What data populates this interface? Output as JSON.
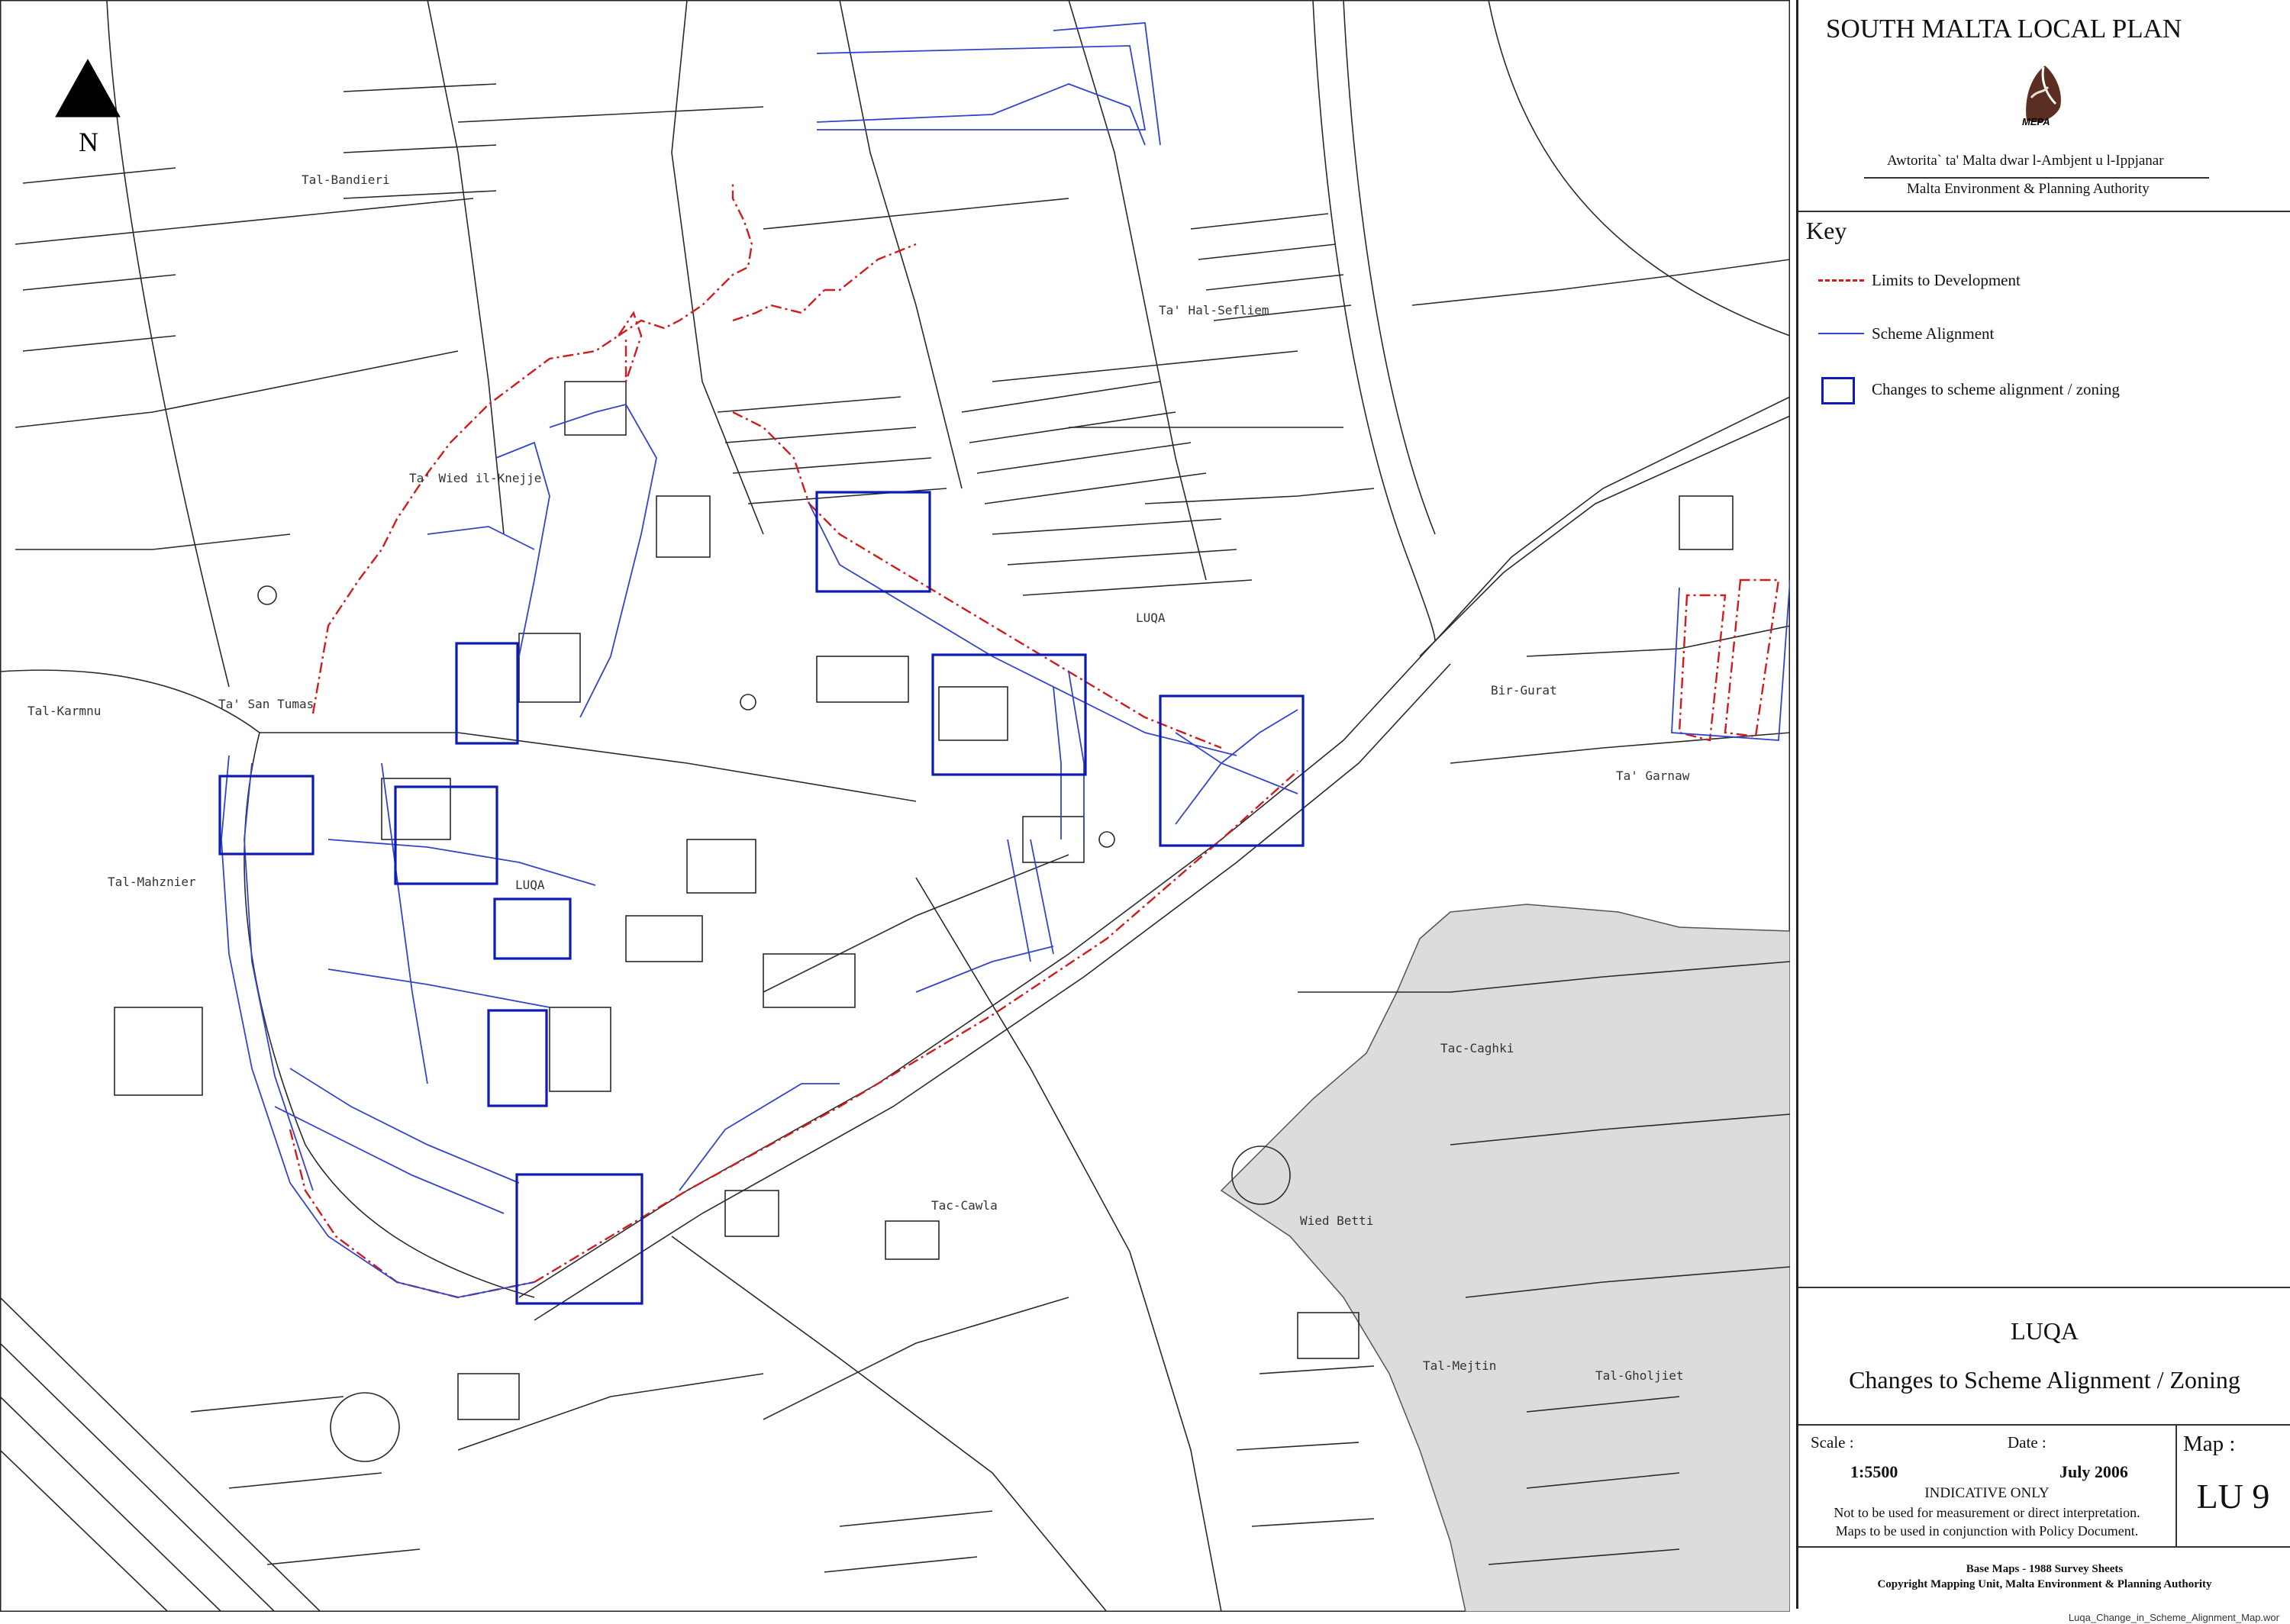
{
  "panel": {
    "plan_title": "SOUTH MALTA LOCAL PLAN",
    "logo_text": "MEPA",
    "authority_maltese": "Awtorita` ta' Malta dwar l-Ambjent u l-Ippjanar",
    "authority_english": "Malta Environment & Planning Authority",
    "key_heading": "Key",
    "key_items": [
      {
        "label": "Limits to Development",
        "symbol": "dash-dot-red-line",
        "color": "#d01c1c"
      },
      {
        "label": "Scheme Alignment",
        "symbol": "thin-blue-line",
        "color": "#3344cc"
      },
      {
        "label": "Changes to scheme alignment / zoning",
        "symbol": "blue-box",
        "color": "#0d1bb3"
      }
    ],
    "locality": "LUQA",
    "map_subject": "Changes to Scheme Alignment / Zoning",
    "scale_label": "Scale :",
    "scale_value": "1:5500",
    "date_label": "Date :",
    "date_value": "July 2006",
    "indicative": "INDICATIVE ONLY",
    "note_1": "Not to be used for measurement or direct interpretation.",
    "note_2": "Maps to be used in conjunction with Policy Document.",
    "map_label": "Map :",
    "map_number": "LU 9",
    "source_1": "Base Maps - 1988 Survey Sheets",
    "source_2": "Copyright Mapping Unit, Malta Environment & Planning Authority"
  },
  "filename": "Luqa_Change_in_Scheme_Alignment_Map.wor",
  "north_label": "N",
  "map_labels": {
    "tal_bandieri": "Tal-Bandieri",
    "ta_hal_sefliem": "Ta' Hal-Sefliem",
    "ta_wied_il_knejjes": "Ta' Wied il-Knejje",
    "luqa_1": "LUQA",
    "luqa_2": "LUQA",
    "bir_gurat": "Bir-Gurat",
    "tal_karmnu": "Tal-Karmnu",
    "ta_san_tumas": "Ta' San Tumas",
    "ta_garnaw": "Ta' Garnaw",
    "tal_mahznier": "Tal-Mahznier",
    "tac_caghki": "Tac-Caghki",
    "tac_cawla": "Tac-Cawla",
    "wied_betti": "Wied Betti",
    "tal_mejtin": "Tal-Mejtin",
    "tal_gholjiet": "Tal-Gholjiet"
  },
  "colors": {
    "limits_line": "#d01c1c",
    "scheme_line": "#3344cc",
    "change_box": "#0d1bb3",
    "base_map": "#2a2a2a",
    "shaded_area": "#dcdcdc"
  }
}
